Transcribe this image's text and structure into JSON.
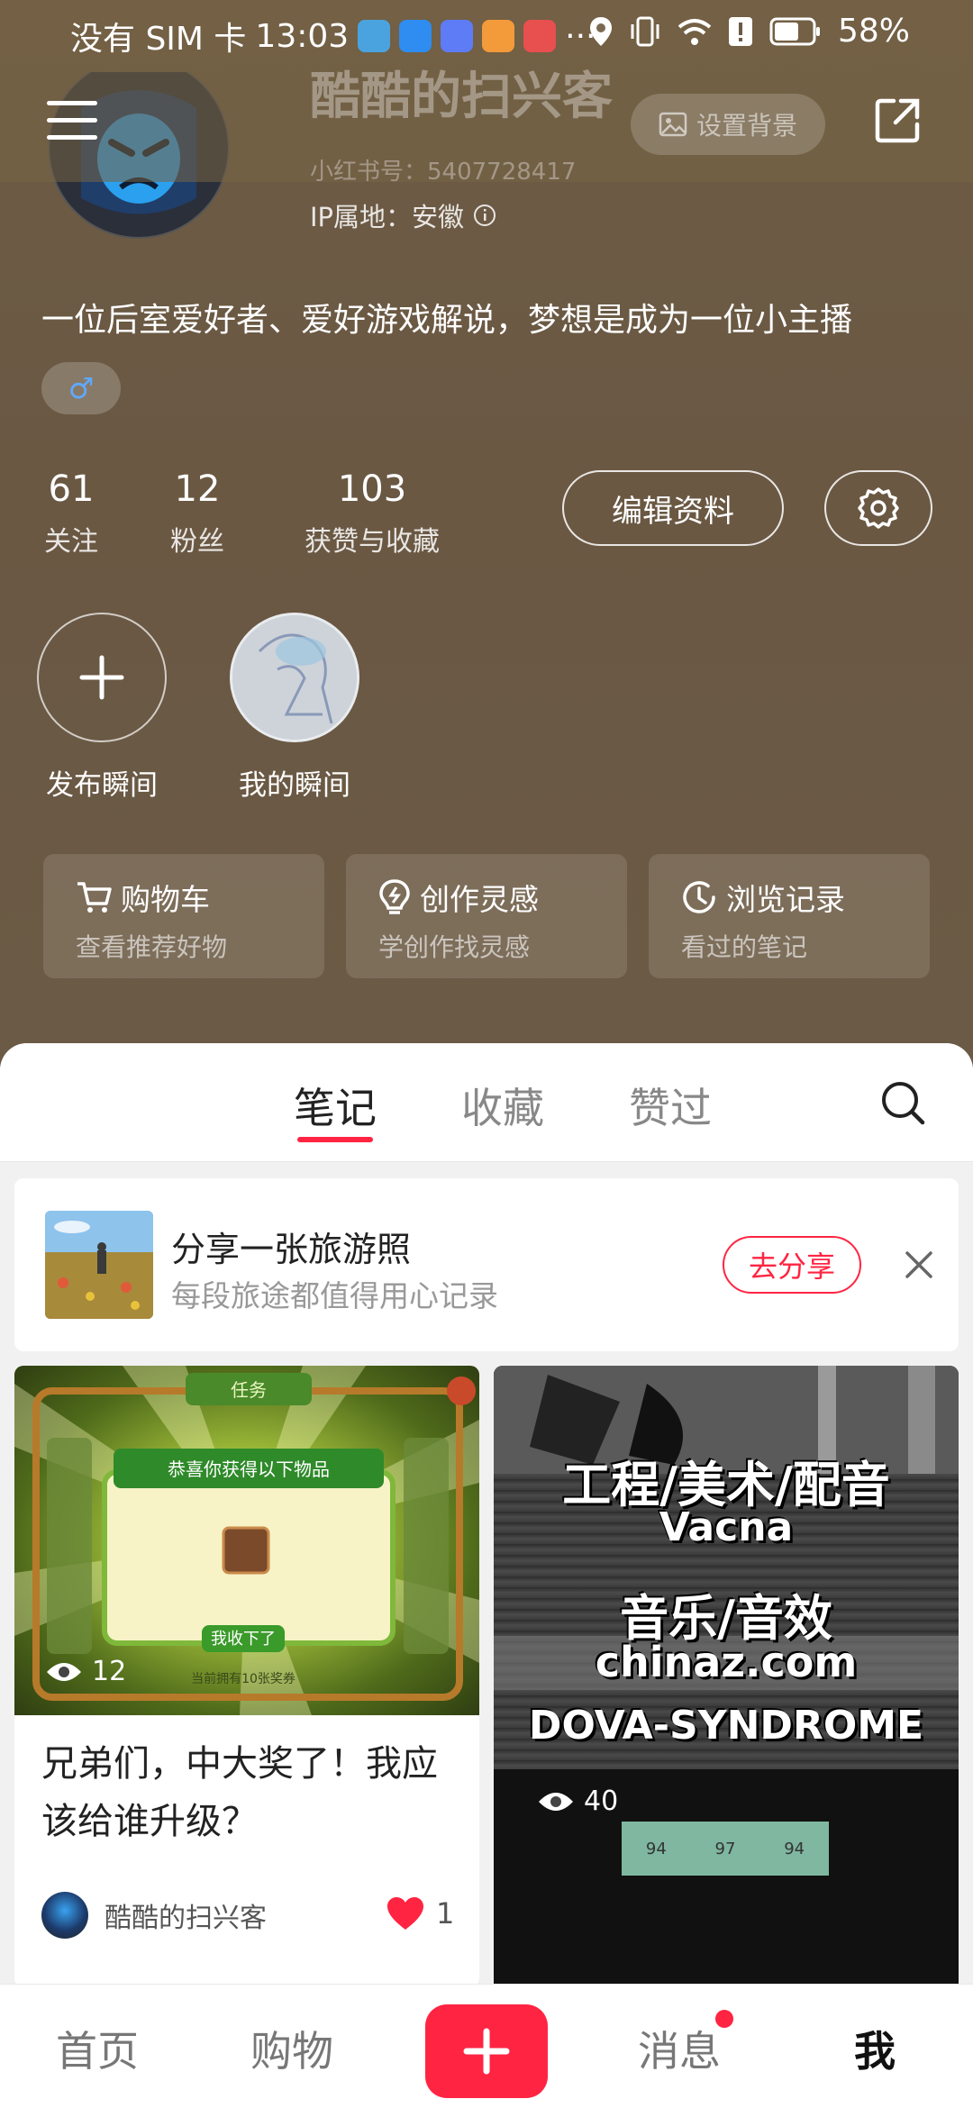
{
  "status_bar": {
    "carrier": "没有 SIM 卡",
    "time": "13:03",
    "more": "···",
    "battery": "58%"
  },
  "profile": {
    "nickname": "酷酷的扫兴客",
    "set_background": "设置背景",
    "xhs_id": "小红书号：5407728417",
    "ip_location": "IP属地：安徽",
    "bio": "一位后室爱好者、爱好游戏解说，梦想是成为一位小主播",
    "gender": "♂",
    "stats": [
      {
        "num": "61",
        "label": "关注"
      },
      {
        "num": "12",
        "label": "粉丝"
      },
      {
        "num": "103",
        "label": "获赞与收藏"
      }
    ],
    "edit_button": "编辑资料",
    "moments": [
      {
        "label": "发布瞬间"
      },
      {
        "label": "我的瞬间"
      }
    ],
    "shortcuts": [
      {
        "title": "购物车",
        "sub": "查看推荐好物",
        "icon": "cart-icon"
      },
      {
        "title": "创作灵感",
        "sub": "学创作找灵感",
        "icon": "bulb-icon"
      },
      {
        "title": "浏览记录",
        "sub": "看过的笔记",
        "icon": "clock-icon"
      }
    ]
  },
  "tabs": [
    "笔记",
    "收藏",
    "赞过"
  ],
  "share_card": {
    "title": "分享一张旅游照",
    "subtitle": "每段旅途都值得用心记录",
    "button": "去分享"
  },
  "notes": [
    {
      "title": "兄弟们，中大奖了！我应该给谁升级？",
      "views": "12",
      "author": "酷酷的扫兴客",
      "likes": "1",
      "image_text": {
        "header": "任务",
        "banner": "恭喜你获得以下物品",
        "button": "我收下了",
        "footer": "当前拥有10张奖券"
      }
    },
    {
      "views": "40",
      "image_text": {
        "line1": "工程/美术/配音",
        "line2": "Vacna",
        "line3": "音乐/音效",
        "line4": "chinaz.com",
        "line5": "DOVA-SYNDROME",
        "bar": [
          "94",
          "97",
          "94"
        ]
      }
    }
  ],
  "bottom_nav": [
    "首页",
    "购物",
    "消息",
    "我"
  ],
  "colors": {
    "accent": "#ff2442",
    "profile_bg": "#6b5a45"
  }
}
